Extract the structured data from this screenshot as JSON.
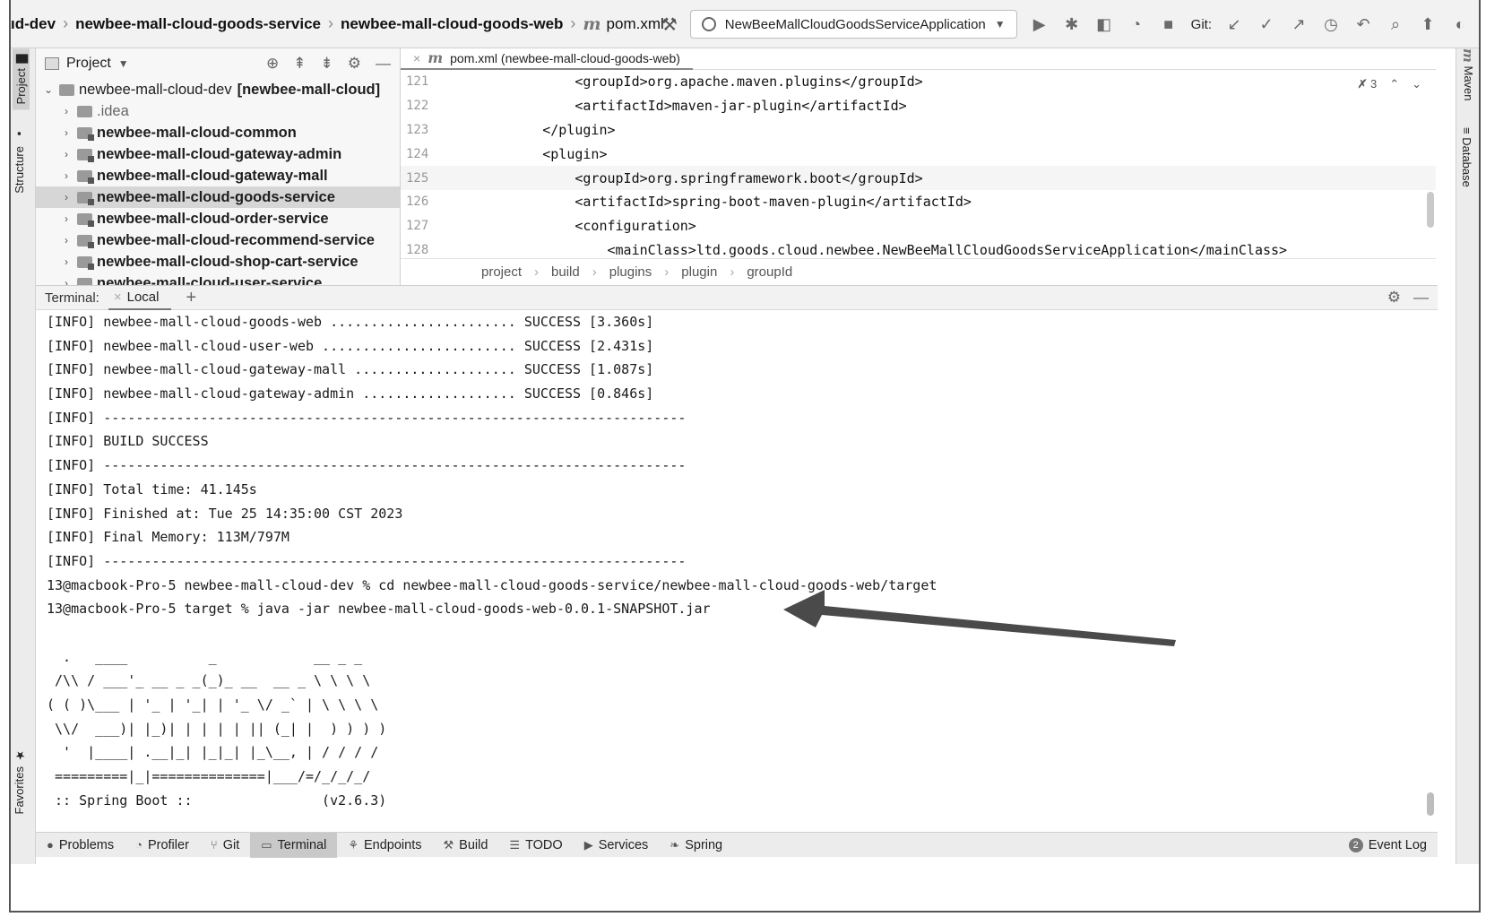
{
  "navbar": {
    "crumbs": [
      "ıd-dev",
      "newbee-mall-cloud-goods-service",
      "newbee-mall-cloud-goods-web"
    ],
    "file": "pom.xml",
    "run_config": "NewBeeMallCloudGoodsServiceApplication",
    "git_label": "Git:"
  },
  "left_strip": {
    "tabs": [
      "Project",
      "Structure",
      "Favorites"
    ]
  },
  "right_strip": {
    "tabs": [
      "Maven",
      "Database"
    ]
  },
  "project": {
    "title": "Project",
    "tree": [
      {
        "label": "newbee-mall-cloud-dev",
        "suffix": "[newbee-mall-cloud]",
        "expanded": true,
        "bold": false
      },
      {
        "label": ".idea",
        "muted": true
      },
      {
        "label": "newbee-mall-cloud-common",
        "bold": true
      },
      {
        "label": "newbee-mall-cloud-gateway-admin",
        "bold": true
      },
      {
        "label": "newbee-mall-cloud-gateway-mall",
        "bold": true
      },
      {
        "label": "newbee-mall-cloud-goods-service",
        "bold": true,
        "selected": true
      },
      {
        "label": "newbee-mall-cloud-order-service",
        "bold": true
      },
      {
        "label": "newbee-mall-cloud-recommend-service",
        "bold": true
      },
      {
        "label": "newbee-mall-cloud-shop-cart-service",
        "bold": true
      },
      {
        "label": "newbee-mall-cloud-user-service",
        "bold": true
      }
    ]
  },
  "editor": {
    "tab": "pom.xml (newbee-mall-cloud-goods-web)",
    "inspections": "3",
    "lines": [
      {
        "num": "121",
        "indent": "            ",
        "text": "<groupId>org.apache.maven.plugins</groupId>"
      },
      {
        "num": "122",
        "indent": "            ",
        "text": "<artifactId>maven-jar-plugin</artifactId>"
      },
      {
        "num": "123",
        "indent": "        ",
        "text": "</plugin>"
      },
      {
        "num": "124",
        "indent": "        ",
        "text": "<plugin>"
      },
      {
        "num": "125",
        "indent": "            ",
        "text": "<groupId>org.springframework.boot</groupId>",
        "highlight": true
      },
      {
        "num": "126",
        "indent": "            ",
        "text": "<artifactId>spring-boot-maven-plugin</artifactId>"
      },
      {
        "num": "127",
        "indent": "            ",
        "text": "<configuration>"
      },
      {
        "num": "128",
        "indent": "                ",
        "text": "<mainClass>ltd.goods.cloud.newbee.NewBeeMallCloudGoodsServiceApplication</mainClass>"
      }
    ],
    "breadcrumb": [
      "project",
      "build",
      "plugins",
      "plugin",
      "groupId"
    ]
  },
  "terminal": {
    "label": "Terminal:",
    "tab": "Local",
    "lines": [
      "[INFO] newbee-mall-cloud-goods-web ....................... SUCCESS [3.360s]",
      "[INFO] newbee-mall-cloud-user-web ........................ SUCCESS [2.431s]",
      "[INFO] newbee-mall-cloud-gateway-mall .................... SUCCESS [1.087s]",
      "[INFO] newbee-mall-cloud-gateway-admin ................... SUCCESS [0.846s]",
      "[INFO] ------------------------------------------------------------------------",
      "[INFO] BUILD SUCCESS",
      "[INFO] ------------------------------------------------------------------------",
      "[INFO] Total time: 41.145s",
      "[INFO] Finished at: Tue 25 14:35:00 CST 2023",
      "[INFO] Final Memory: 113M/797M",
      "[INFO] ------------------------------------------------------------------------",
      "13@macbook-Pro-5 newbee-mall-cloud-dev % cd newbee-mall-cloud-goods-service/newbee-mall-cloud-goods-web/target",
      "13@macbook-Pro-5 target % java -jar newbee-mall-cloud-goods-web-0.0.1-SNAPSHOT.jar",
      "",
      "  .   ____          _            __ _ _",
      " /\\\\ / ___'_ __ _ _(_)_ __  __ _ \\ \\ \\ \\",
      "( ( )\\___ | '_ | '_| | '_ \\/ _` | \\ \\ \\ \\",
      " \\\\/  ___)| |_)| | | | | || (_| |  ) ) ) )",
      "  '  |____| .__|_| |_|_| |_\\__, | / / / /",
      " =========|_|==============|___/=/_/_/_/",
      " :: Spring Boot ::                (v2.6.3)"
    ]
  },
  "bottombar": {
    "items": [
      {
        "icon": "problems-icon",
        "label": "Problems"
      },
      {
        "icon": "profiler-icon",
        "label": "Profiler"
      },
      {
        "icon": "git-icon",
        "label": "Git"
      },
      {
        "icon": "terminal-icon",
        "label": "Terminal",
        "active": true
      },
      {
        "icon": "endpoints-icon",
        "label": "Endpoints"
      },
      {
        "icon": "build-icon",
        "label": "Build"
      },
      {
        "icon": "todo-icon",
        "label": "TODO"
      },
      {
        "icon": "services-icon",
        "label": "Services"
      },
      {
        "icon": "spring-icon",
        "label": "Spring"
      }
    ],
    "event_log": "Event Log",
    "event_count": "2"
  }
}
